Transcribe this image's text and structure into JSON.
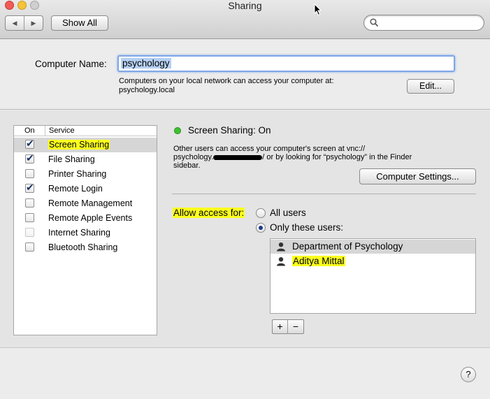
{
  "window": {
    "title": "Sharing"
  },
  "toolbar": {
    "back_glyph": "◀",
    "forward_glyph": "▶",
    "show_all_label": "Show All",
    "search_value": ""
  },
  "computer_name": {
    "label": "Computer Name:",
    "value": "psychology",
    "info_line1": "Computers on your local network can access your computer at:",
    "info_line2": "psychology.local",
    "edit_label": "Edit..."
  },
  "services": {
    "header_on": "On",
    "header_service": "Service",
    "items": [
      {
        "label": "Screen Sharing",
        "checked": true,
        "selected": true,
        "highlighted": true
      },
      {
        "label": "File Sharing",
        "checked": true
      },
      {
        "label": "Printer Sharing",
        "checked": false
      },
      {
        "label": "Remote Login",
        "checked": true
      },
      {
        "label": "Remote Management",
        "checked": false
      },
      {
        "label": "Remote Apple Events",
        "checked": false
      },
      {
        "label": "Internet Sharing",
        "checked": false,
        "disabled": true
      },
      {
        "label": "Bluetooth Sharing",
        "checked": false
      }
    ]
  },
  "detail": {
    "status": "Screen Sharing: On",
    "status_color": "#3ec22f",
    "desc_line1": "Other users can access your computer's screen at vnc://",
    "desc_line2_a": "psychology.",
    "desc_line2_b": "/ or by looking for “psychology” in the Finder",
    "desc_line3": "sidebar.",
    "computer_settings_label": "Computer Settings...",
    "allow_access_label": "Allow access for:",
    "all_users_label": "All users",
    "only_these_label": "Only these users:",
    "users": [
      {
        "name": "Department of Psychology",
        "selected": true
      },
      {
        "name": "Aditya Mittal",
        "highlighted": true
      }
    ],
    "add_glyph": "+",
    "remove_glyph": "−"
  },
  "help": {
    "glyph": "?"
  },
  "colors": {
    "highlight": "#fbff1e",
    "selection": "#d6d6d6",
    "focus": "#7fa6e6"
  }
}
